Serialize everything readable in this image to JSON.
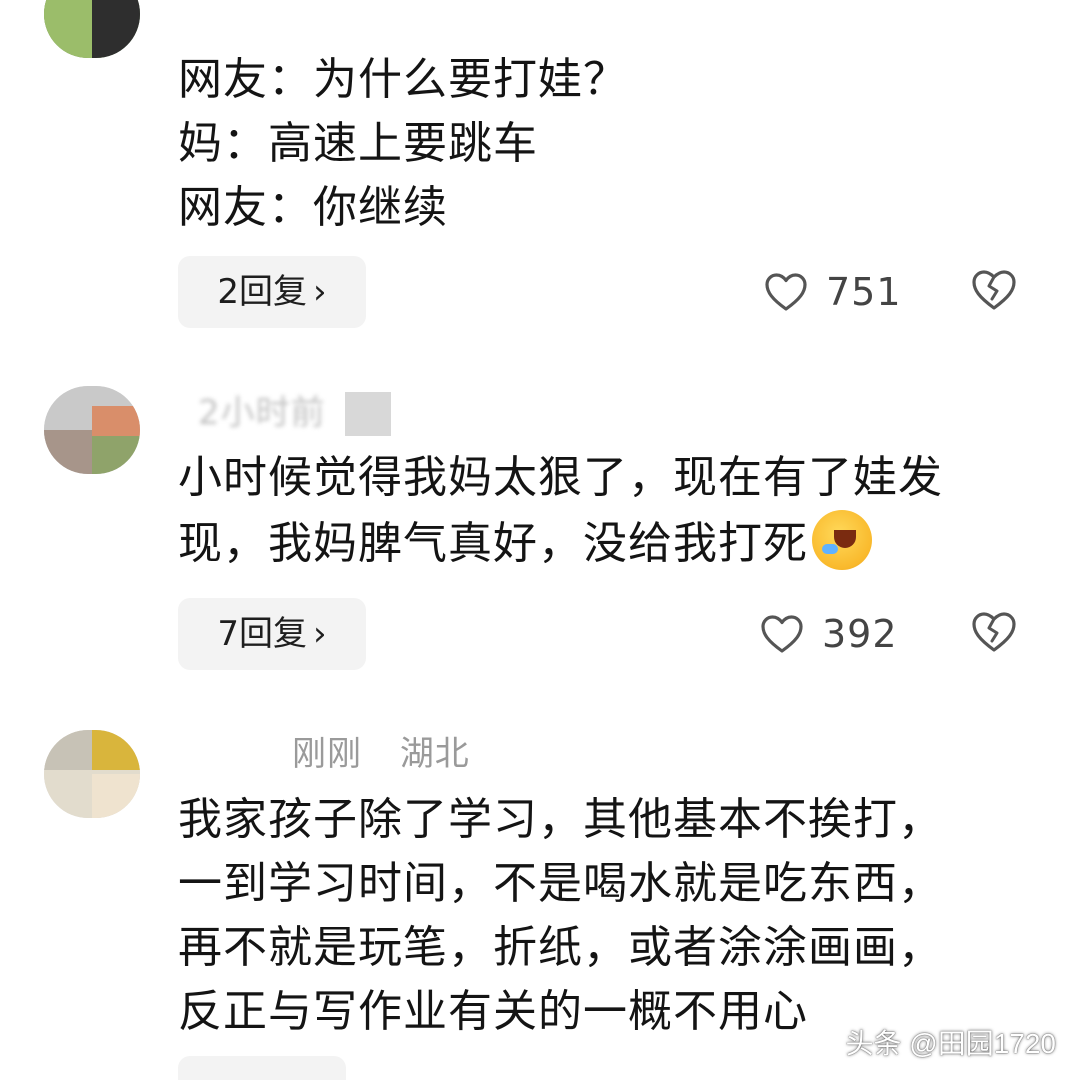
{
  "comments": [
    {
      "meta": {
        "name": "",
        "time": "",
        "location": ""
      },
      "lines": [
        "网友：为什么要打娃？",
        "妈：高速上要跳车",
        "网友：你继续"
      ],
      "reply_label": "2回复",
      "like_count": "751"
    },
    {
      "meta": {
        "name": "",
        "time": "2小时前",
        "location": ""
      },
      "lines": [
        "小时候觉得我妈太狠了，现在有了娃发",
        "现，我妈脾气真好，没给我打死"
      ],
      "reply_label": "7回复",
      "like_count": "392",
      "emoji": "laughing-crying-emoji"
    },
    {
      "meta": {
        "name": "",
        "time": "刚刚",
        "location": "湖北"
      },
      "lines": [
        "我家孩子除了学习，其他基本不挨打，",
        "一到学习时间，不是喝水就是吃东西，",
        "再不就是玩笔，折纸，或者涂涂画画，",
        "反正与写作业有关的一概不用心"
      ]
    }
  ],
  "watermark": "头条 @田园1720",
  "icons": {
    "like": "heart-outline-icon",
    "dislike": "broken-heart-icon",
    "reply_chevron": "chevron-right-icon"
  },
  "colors": {
    "text": "#141414",
    "meta": "#9a9a9a",
    "reply_bg": "#f3f3f3",
    "icon": "#555555"
  }
}
